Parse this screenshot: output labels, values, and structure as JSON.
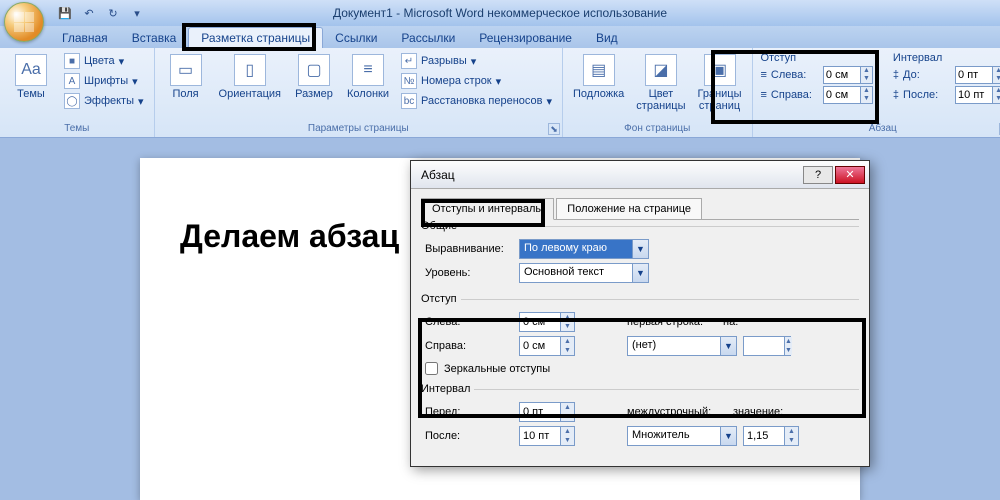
{
  "title": "Документ1 - Microsoft Word некоммерческое использование",
  "tabs": [
    "Главная",
    "Вставка",
    "Разметка страницы",
    "Ссылки",
    "Рассылки",
    "Рецензирование",
    "Вид"
  ],
  "active_tab": 2,
  "groups": {
    "themes": {
      "title": "Темы",
      "btn": "Темы",
      "colors": "Цвета",
      "fonts": "Шрифты",
      "effects": "Эффекты"
    },
    "pagesetup": {
      "title": "Параметры страницы",
      "margins": "Поля",
      "orient": "Ориентация",
      "size": "Размер",
      "columns": "Колонки",
      "breaks": "Разрывы",
      "linenum": "Номера строк",
      "hyphen": "Расстановка переносов"
    },
    "pagebg": {
      "title": "Фон страницы",
      "watermark": "Подложка",
      "color": "Цвет\nстраницы",
      "borders": "Границы\nстраниц"
    },
    "paragraph": {
      "title": "Абзац",
      "indent_hdr": "Отступ",
      "left": "Слева:",
      "right": "Справа:",
      "left_val": "0 см",
      "right_val": "0 см",
      "spacing_hdr": "Интервал",
      "before": "До:",
      "after": "После:",
      "before_val": "0 пт",
      "after_val": "10 пт"
    }
  },
  "doc_text": "Делаем абзац",
  "dialog": {
    "title": "Абзац",
    "tab1": "Отступы и интервалы",
    "tab2": "Положение на странице",
    "general": "Общие",
    "align_lbl": "Выравнивание:",
    "align_val": "По левому краю",
    "level_lbl": "Уровень:",
    "level_val": "Основной текст",
    "indent": "Отступ",
    "left_lbl": "Слева:",
    "left_val": "0 см",
    "right_lbl": "Справа:",
    "right_val": "0 см",
    "firstline_lbl": "первая строка:",
    "firstline_val": "(нет)",
    "by_lbl": "на:",
    "by_val": "",
    "mirror": "Зеркальные отступы",
    "spacing": "Интервал",
    "before_lbl": "Перед:",
    "before_val": "0 пт",
    "after_lbl": "После:",
    "after_val": "10 пт",
    "linespc_lbl": "междустрочный:",
    "linespc_val": "Множитель",
    "value_lbl": "значение:",
    "value_val": "1,15"
  }
}
